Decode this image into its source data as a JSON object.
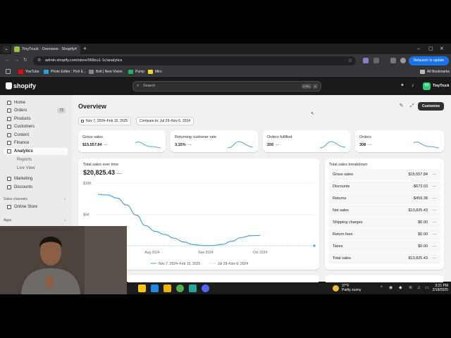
{
  "browser": {
    "tab_title": "TinyTruck · Overview · Shopify",
    "url": "admin.shopify.com/store/068zu1-1c/analytics",
    "relaunch_label": "Relaunch to update",
    "bookmarks": [
      {
        "label": "YouTube",
        "color": "#ff0000"
      },
      {
        "label": "Photo Editor : Pixlr E...",
        "color": "#2d9cdb"
      },
      {
        "label": "Bolt | New Vision",
        "color": "#888888"
      },
      {
        "label": "Pump",
        "color": "#27ae60"
      },
      {
        "label": "Miro",
        "color": "#ffd02f"
      }
    ],
    "all_bookmarks_label": "All Bookmarks"
  },
  "shopify": {
    "logo_text": "shopify",
    "search_placeholder": "Search",
    "kbd_ctrl": "CTRL",
    "kbd_k": "K",
    "store_initials": "TT",
    "store_name": "TinyTruck"
  },
  "sidebar": {
    "items": [
      {
        "label": "Home"
      },
      {
        "label": "Orders",
        "badge": "72"
      },
      {
        "label": "Products"
      },
      {
        "label": "Customers"
      },
      {
        "label": "Content"
      },
      {
        "label": "Finance"
      },
      {
        "label": "Analytics"
      },
      {
        "label": "Reports"
      },
      {
        "label": "Live View"
      },
      {
        "label": "Marketing"
      },
      {
        "label": "Discounts"
      }
    ],
    "sales_channels_heading": "Sales channels",
    "online_store": "Online Store",
    "apps_heading": "Apps"
  },
  "main": {
    "title": "Overview",
    "customize_label": "Customize",
    "date_range": "Nov 7, 2024–Feb 15, 2025",
    "compare_range": "Compare to: Jul 29–Nov 6, 2024",
    "metrics": [
      {
        "label": "Gross sales",
        "value": "$15,557.84",
        "delta": "—"
      },
      {
        "label": "Returning customer rate",
        "value": "3.15%",
        "delta": "—"
      },
      {
        "label": "Orders fulfilled",
        "value": "200",
        "delta": "—"
      },
      {
        "label": "Orders",
        "value": "308",
        "delta": "—"
      }
    ],
    "chart_card": {
      "title": "Total sales over time",
      "value": "$20,825.43",
      "delta": "—"
    },
    "breakdown": {
      "title": "Total sales breakdown",
      "rows": [
        {
          "label": "Gross sales",
          "value": "$15,557.84",
          "delta": "—"
        },
        {
          "label": "Discounts",
          "value": "-$673.03",
          "delta": "—"
        },
        {
          "label": "Returns",
          "value": "-$459.38",
          "delta": "—"
        },
        {
          "label": "Net sales",
          "value": "$13,825.43",
          "delta": "—"
        },
        {
          "label": "Shipping charges",
          "value": "$0.00",
          "delta": "—"
        },
        {
          "label": "Return fees",
          "value": "$0.00",
          "delta": "—"
        },
        {
          "label": "Taxes",
          "value": "$0.00",
          "delta": "—"
        },
        {
          "label": "Total sales",
          "value": "$13,825.43",
          "delta": "—"
        }
      ]
    }
  },
  "chart_data": {
    "type": "line",
    "title": "Total sales over time",
    "yticks": [
      "$10K",
      "$5K"
    ],
    "ylim": [
      0,
      10000
    ],
    "xticks": [
      "Aug 2024",
      "Sep 2024",
      "Oct 2024"
    ],
    "series": [
      {
        "name": "Nov 7, 2024–Feb 15, 2025",
        "color": "#4da3d9",
        "values": [
          8200,
          8100,
          7600,
          6500,
          4900,
          3200,
          2300,
          1800,
          1200,
          600,
          180,
          40,
          40,
          200,
          700,
          1300,
          1600,
          1650
        ]
      },
      {
        "name": "Jul 29–Nov 6, 2024",
        "color": "#9cc7e6",
        "values": [
          0,
          0,
          0,
          0,
          0,
          0,
          0,
          0,
          0,
          0,
          0,
          0,
          0,
          0,
          0,
          0,
          0,
          0,
          0,
          0,
          0,
          0,
          0,
          0,
          0,
          0,
          0,
          0,
          0,
          0,
          0,
          0,
          0,
          0,
          0,
          0
        ]
      }
    ],
    "grid": true,
    "legend": "bottom"
  },
  "taskbar": {
    "weather_temp": "37°F",
    "weather_desc": "Partly sunny",
    "time": "3:21 PM",
    "date": "2/18/2025"
  },
  "colors": {
    "shopify_dark": "#1a1a1a",
    "sidebar_bg": "#ebebeb",
    "main_bg": "#f1f1f1",
    "accent_blue": "#1a73e8",
    "series_blue": "#4da3d9"
  }
}
